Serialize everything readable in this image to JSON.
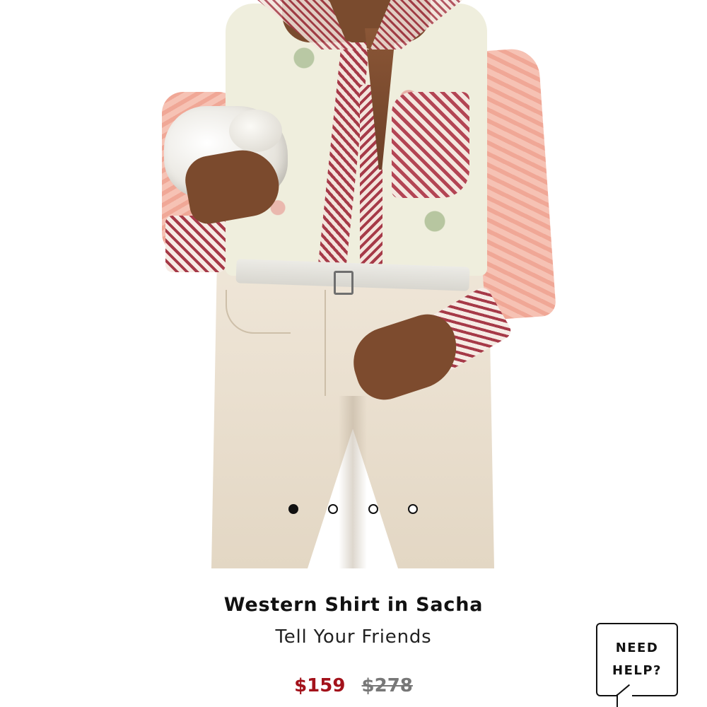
{
  "product": {
    "title": "Western Shirt in Sacha",
    "brand": "Tell Your Friends",
    "price_sale": "$159",
    "price_original": "$278"
  },
  "carousel": {
    "total_slides": 4,
    "active_index": 0
  },
  "help_widget": {
    "line1": "NEED",
    "line2": "HELP?"
  },
  "colors": {
    "sale_price": "#a3121b",
    "original_price": "#777777",
    "text_primary": "#111111",
    "dot_active": "#111111"
  },
  "icons": {
    "help": "chat-bubble-icon"
  }
}
